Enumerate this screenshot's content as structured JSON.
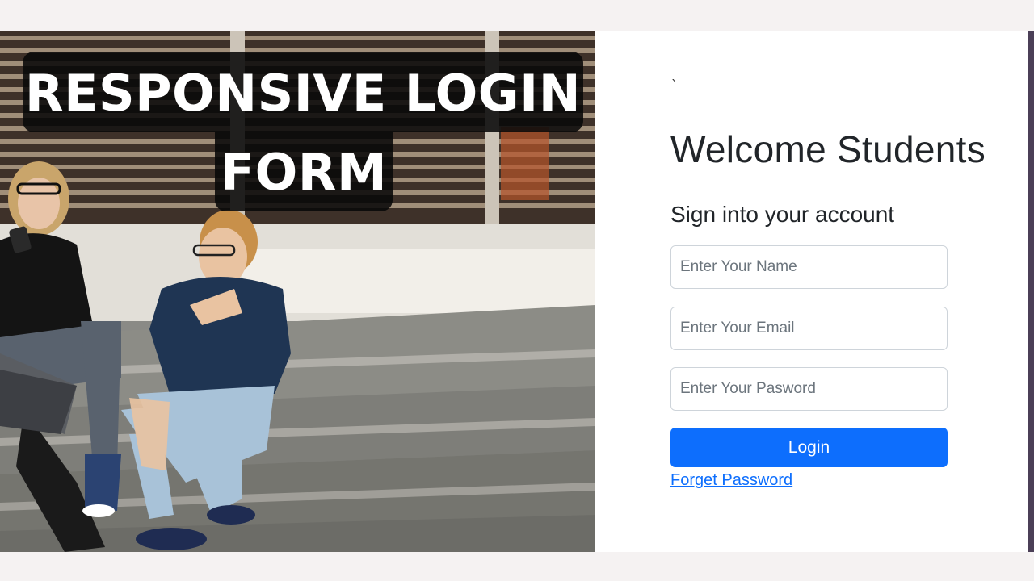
{
  "banner": {
    "line1": "RESPONSIVE LOGIN",
    "line2": "FORM"
  },
  "login": {
    "mark": "`",
    "title": "Welcome Students",
    "subtitle": "Sign into your account",
    "name_placeholder": "Enter Your Name",
    "email_placeholder": "Enter Your Email",
    "password_placeholder": "Enter Your Pasword",
    "login_label": "Login",
    "forget_label": "Forget Password"
  },
  "colors": {
    "primary": "#0d6efd",
    "text": "#212529",
    "field_border": "#ced4da",
    "banner_bg": "#080808"
  },
  "photo": {
    "subject": "students-on-steps-photo"
  }
}
